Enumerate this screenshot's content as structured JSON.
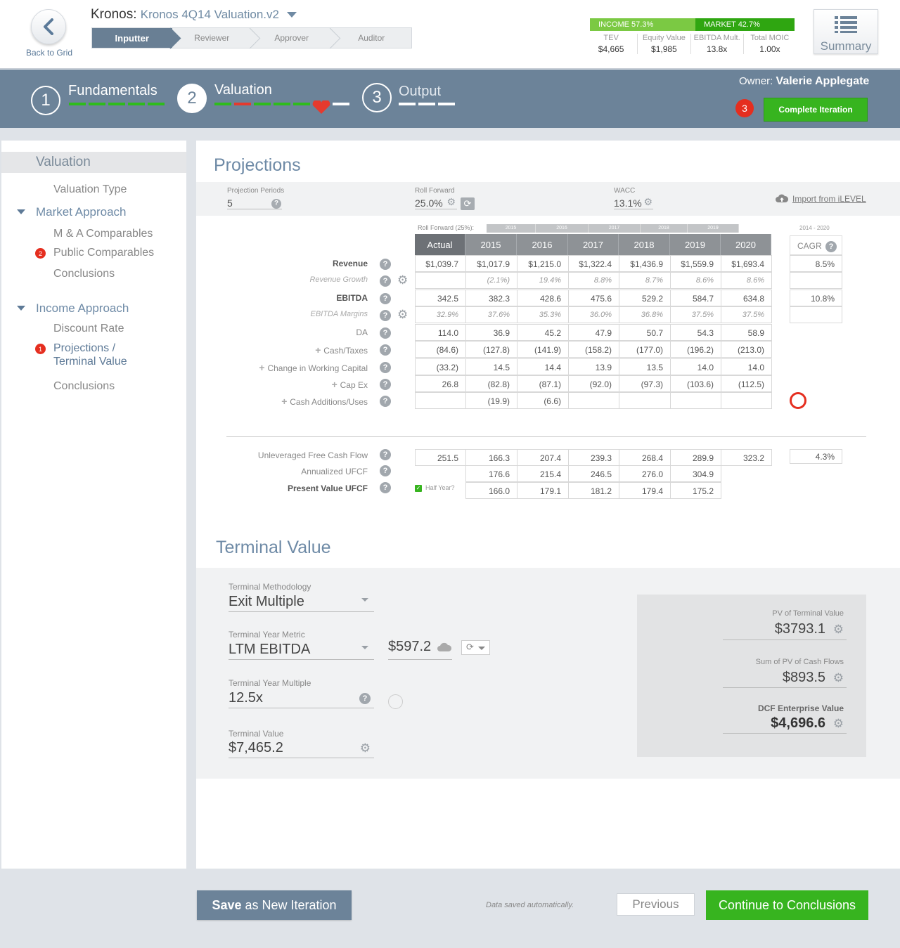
{
  "header": {
    "back_label": "Back to Grid",
    "company": "Kronos:",
    "file": "Kronos 4Q14 Valuation.v2",
    "workflow": [
      "Inputter",
      "Reviewer",
      "Approver",
      "Auditor"
    ],
    "income_label": "INCOME 57.3%",
    "market_label": "MARKET 42.7%",
    "kpis": [
      {
        "label": "TEV",
        "value": "$4,665"
      },
      {
        "label": "Equity Value",
        "value": "$1,985"
      },
      {
        "label": "EBITDA Mult.",
        "value": "13.8x"
      },
      {
        "label": "Total MOIC",
        "value": "1.00x"
      }
    ],
    "summary_label": "Summary"
  },
  "steps": [
    {
      "num": "1",
      "title": "Fundamentals"
    },
    {
      "num": "2",
      "title": "Valuation"
    },
    {
      "num": "3",
      "title": "Output"
    }
  ],
  "owner_label": "Owner:",
  "owner_name": "Valerie Applegate",
  "complete_badge": "3",
  "complete_label": "Complete Iteration",
  "sidebar": {
    "title": "Valuation",
    "valuation_type": "Valuation Type",
    "market_approach": "Market Approach",
    "ma_comparables": "M & A Comparables",
    "public_comparables": "Public Comparables",
    "public_badge": "2",
    "conclusions_market": "Conclusions",
    "income_approach": "Income Approach",
    "discount_rate": "Discount Rate",
    "projections_line1": "Projections /",
    "projections_line2": "Terminal Value",
    "projections_badge": "1",
    "conclusions_income": "Conclusions"
  },
  "projections": {
    "title": "Projections",
    "periods_label": "Projection Periods",
    "periods_value": "5",
    "roll_label": "Roll Forward",
    "roll_value": "25.0%",
    "wacc_label": "WACC",
    "wacc_value": "13.1%",
    "import_label": "Import from iLEVEL",
    "roll_caption": "Roll Forward (25%):",
    "roll_years": [
      "2015",
      "2016",
      "2017",
      "2018",
      "2019"
    ],
    "cagr_range": "2014 - 2020",
    "cagr_label": "CAGR",
    "columns": [
      "Actual",
      "2015",
      "2016",
      "2017",
      "2018",
      "2019",
      "2020"
    ],
    "rows": [
      {
        "label": "Revenue",
        "values": [
          "$1,039.7",
          "$1,017.9",
          "$1,215.0",
          "$1,322.4",
          "$1,436.9",
          "$1,559.9",
          "$1,693.4"
        ],
        "cagr": "8.5%"
      },
      {
        "label": "Revenue Growth",
        "values": [
          "",
          "(2.1%)",
          "19.4%",
          "8.8%",
          "8.7%",
          "8.6%",
          "8.6%"
        ],
        "cagr": ""
      },
      {
        "label": "EBITDA",
        "values": [
          "342.5",
          "382.3",
          "428.6",
          "475.6",
          "529.2",
          "584.7",
          "634.8"
        ],
        "cagr": "10.8%"
      },
      {
        "label": "EBITDA Margins",
        "values": [
          "32.9%",
          "37.6%",
          "35.3%",
          "36.0%",
          "36.8%",
          "37.5%",
          "37.5%"
        ],
        "cagr": ""
      },
      {
        "label": "DA",
        "values": [
          "114.0",
          "36.9",
          "45.2",
          "47.9",
          "50.7",
          "54.3",
          "58.9"
        ]
      },
      {
        "label": "Cash/Taxes",
        "values": [
          "(84.6)",
          "(127.8)",
          "(141.9)",
          "(158.2)",
          "(177.0)",
          "(196.2)",
          "(213.0)"
        ]
      },
      {
        "label": "Change in Working Capital",
        "values": [
          "(33.2)",
          "14.5",
          "14.4",
          "13.9",
          "13.5",
          "14.0",
          "14.0"
        ]
      },
      {
        "label": "Cap Ex",
        "values": [
          "26.8",
          "(82.8)",
          "(87.1)",
          "(92.0)",
          "(97.3)",
          "(103.6)",
          "(112.5)"
        ]
      },
      {
        "label": "Cash Additions/Uses",
        "values": [
          "",
          "(19.9)",
          "(6.6)",
          "",
          "",
          "",
          ""
        ]
      }
    ],
    "ufcf": {
      "label": "Unleveraged Free Cash Flow",
      "values": [
        "251.5",
        "166.3",
        "207.4",
        "239.3",
        "268.4",
        "289.9",
        "323.2"
      ],
      "cagr": "4.3%"
    },
    "annualized": {
      "label": "Annualized UFCF",
      "values": [
        "176.6",
        "215.4",
        "246.5",
        "276.0",
        "304.9"
      ]
    },
    "pv": {
      "label": "Present Value UFCF",
      "values": [
        "166.0",
        "179.1",
        "181.2",
        "179.4",
        "175.2"
      ]
    },
    "half_year": "Half Year?"
  },
  "terminal": {
    "title": "Terminal Value",
    "methodology_label": "Terminal Methodology",
    "methodology_value": "Exit Multiple",
    "metric_label": "Terminal Year Metric",
    "metric_value": "LTM EBITDA",
    "metric_amount": "$597.2",
    "multiple_label": "Terminal Year Multiple",
    "multiple_value": "12.5x",
    "tv_label": "Terminal Value",
    "tv_value": "$7,465.2",
    "pv_tv_label": "PV of Terminal Value",
    "pv_tv_value": "$3793.1",
    "sum_pv_label": "Sum of PV of Cash Flows",
    "sum_pv_value": "$893.5",
    "dcf_label": "DCF Enterprise Value",
    "dcf_value": "$4,696.6"
  },
  "footer": {
    "save_bold": "Save",
    "save_rest": " as New Iteration",
    "autosave": "Data saved automatically.",
    "previous": "Previous",
    "continue": "Continue to Conclusions"
  },
  "colors": {
    "green": "#37b41f",
    "slate": "#6c8399",
    "red": "#e52e1f"
  }
}
